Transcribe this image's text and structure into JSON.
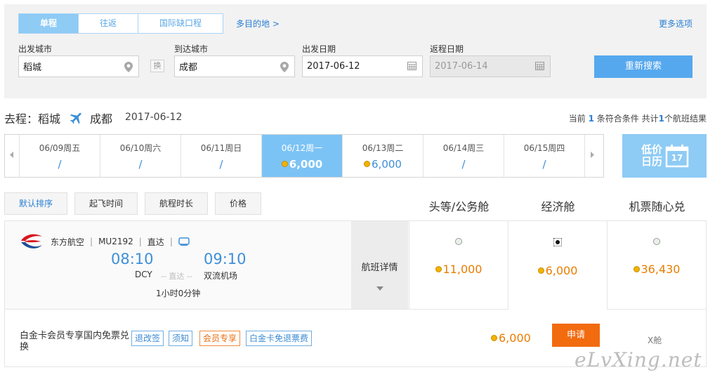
{
  "trip_tabs": [
    {
      "label": "单程",
      "active": true
    },
    {
      "label": "往返",
      "active": false
    },
    {
      "label": "国际缺口程",
      "active": false
    }
  ],
  "multi_city_link": "多目的地 >",
  "more_options_link": "更多选项",
  "search": {
    "from_label": "出发城市",
    "from_value": "稻城",
    "swap_label": "换",
    "to_label": "到达城市",
    "to_value": "成都",
    "depart_label": "出发日期",
    "depart_value": "2017-06-12",
    "return_label": "返程日期",
    "return_value": "2017-06-14",
    "search_button": "重新搜索"
  },
  "route": {
    "prefix": "去程：",
    "from": "稻城",
    "to": "成都",
    "date": "2017-06-12"
  },
  "result_count": {
    "t1": "当前",
    "current": "1",
    "t2": "条符合条件 共计",
    "total": "1",
    "t3": "个航班结果"
  },
  "date_strip": [
    {
      "date": "06/09周五",
      "price": "/",
      "has_price": false,
      "active": false
    },
    {
      "date": "06/10周六",
      "price": "/",
      "has_price": false,
      "active": false
    },
    {
      "date": "06/11周日",
      "price": "/",
      "has_price": false,
      "active": false
    },
    {
      "date": "06/12周一",
      "price": "6,000",
      "has_price": true,
      "active": true
    },
    {
      "date": "06/13周二",
      "price": "6,000",
      "has_price": true,
      "active": false
    },
    {
      "date": "06/14周三",
      "price": "/",
      "has_price": false,
      "active": false
    },
    {
      "date": "06/15周四",
      "price": "/",
      "has_price": false,
      "active": false
    }
  ],
  "low_price_calendar": {
    "line1": "低价",
    "line2": "日历",
    "day": "17"
  },
  "sort_buttons": [
    "默认排序",
    "起飞时间",
    "航程时长",
    "价格"
  ],
  "cabin_headers": [
    "头等/公务舱",
    "经济舱",
    "机票随心兑"
  ],
  "flight": {
    "airline": "东方航空",
    "flight_no": "MU2192",
    "type": "直达",
    "depart_time": "08:10",
    "arrive_time": "09:10",
    "depart_airport": "DCY",
    "via": "-- 直达 --",
    "arrive_airport": "双流机场",
    "duration": "1小时0分钟",
    "detail_label": "航班详情",
    "prices": [
      "11,000",
      "6,000",
      "36,430"
    ]
  },
  "member_offer": {
    "title": "白金卡会员专享国内免票兑换",
    "tags": [
      "退改签",
      "须知",
      "会员专享",
      "白金卡免退票费"
    ],
    "price": "6,000",
    "apply_button": "申请",
    "cabin_class": "X舱"
  },
  "watermark": "eLvXing.net",
  "colors": {
    "accent_blue": "#56a8ee",
    "active_tab_blue": "#8ecbf5",
    "price_orange": "#e97d00",
    "apply_orange": "#f26b0f",
    "airline_red": "#d7161e",
    "airline_blue": "#1f4e9a"
  }
}
